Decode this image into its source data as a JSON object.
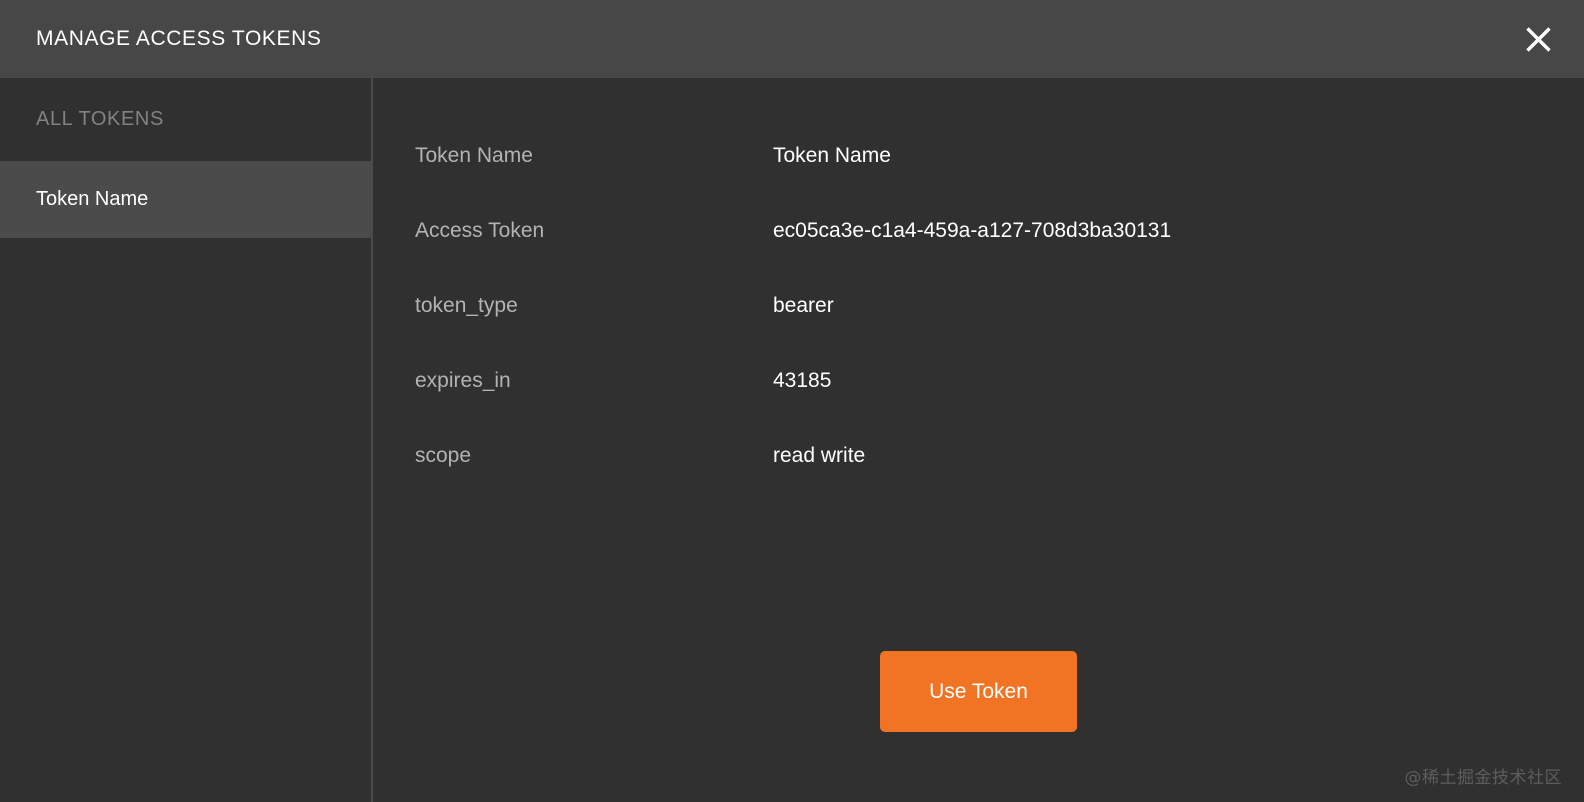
{
  "window": {
    "title": "MANAGE ACCESS TOKENS",
    "close_icon": "close-icon"
  },
  "sidebar": {
    "header": "ALL TOKENS",
    "items": [
      {
        "label": "Token Name",
        "selected": true
      }
    ]
  },
  "main": {
    "rows": [
      {
        "label": "Token Name",
        "value": "Token Name"
      },
      {
        "label": "Access Token",
        "value": "ec05ca3e-c1a4-459a-a127-708d3ba30131"
      },
      {
        "label": "token_type",
        "value": "bearer"
      },
      {
        "label": "expires_in",
        "value": "43185"
      },
      {
        "label": "scope",
        "value": "read write"
      }
    ],
    "primary_action": "Use Token"
  },
  "watermark": "@稀土掘金技术社区",
  "colors": {
    "titlebar_bg": "#474747",
    "body_bg": "#303030",
    "selected_bg": "#4b4b4b",
    "divider": "#4b4b4b",
    "accent": "#f07423",
    "label_text": "#b3b3b3",
    "muted_text": "#828282",
    "value_text": "#ffffff"
  }
}
